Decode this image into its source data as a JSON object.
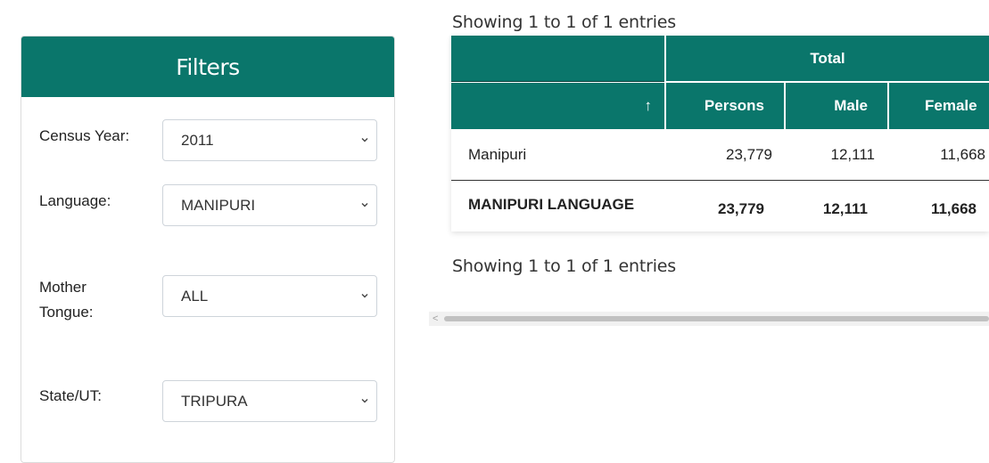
{
  "filters": {
    "title": "Filters",
    "fields": [
      {
        "label": "Census Year:",
        "value": "2011"
      },
      {
        "label": "Language:",
        "value": "MANIPURI"
      },
      {
        "label_line1": "Mother",
        "label_line2": "Tongue:",
        "value": "ALL"
      },
      {
        "label": "State/UT:",
        "value": "TRIPURA"
      }
    ]
  },
  "table": {
    "info_top": "Showing 1 to 1 of 1 entries",
    "info_bottom": "Showing 1 to 1 of 1 entries",
    "group_header": "Total",
    "sort_indicator": "↑",
    "columns": [
      "Persons",
      "Male",
      "Female"
    ],
    "rows": [
      {
        "name": "Manipuri",
        "persons": "23,779",
        "male": "12,111",
        "female": "11,668"
      }
    ],
    "total_row": {
      "name": "MANIPURI LANGUAGE",
      "persons": "23,779",
      "male": "12,111",
      "female": "11,668"
    }
  },
  "scrollbar": {
    "arrow": "<"
  },
  "colors": {
    "header_teal": "#0a766b"
  },
  "icons": {
    "select_arrow": "chevron-down-icon",
    "sort": "sort-ascending-icon"
  }
}
